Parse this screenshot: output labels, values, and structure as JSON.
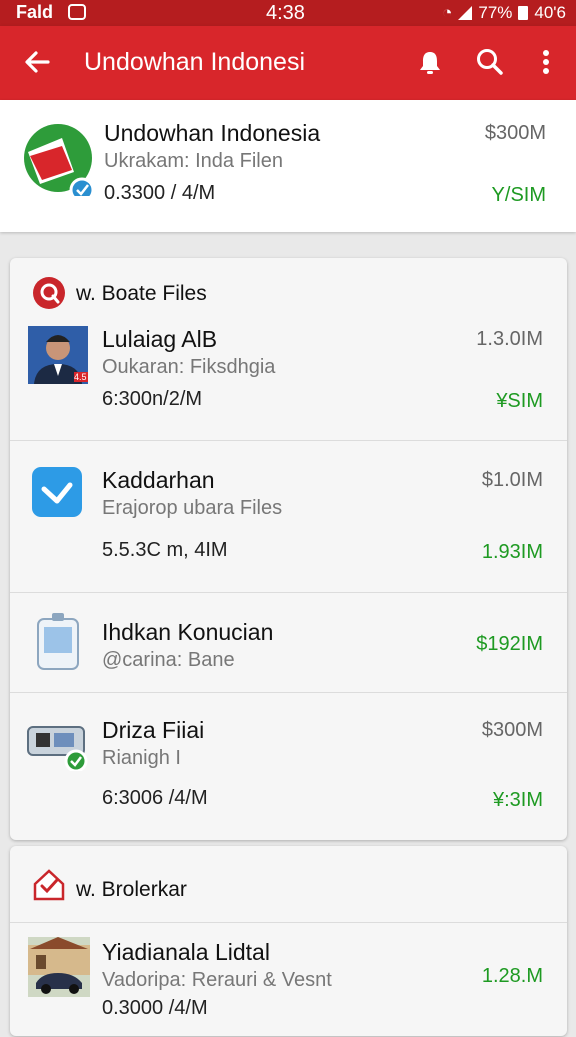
{
  "status_bar": {
    "left": "Fald",
    "time": "4:38",
    "battery": "77%",
    "right": "40'6"
  },
  "app_bar": {
    "title": "Undowhan Indonesi"
  },
  "top_item": {
    "name": "Undowhan Indonesia",
    "sub": "Ukrakam: Inda Filen",
    "meta": "0.3300 / 4/M",
    "price": "$300M",
    "green": "Y/SIM"
  },
  "section1": {
    "title": "w. Boate Files",
    "items": [
      {
        "name": "Lulaiag AlB",
        "sub": "Oukaran: Fiksdhgia",
        "meta": "6:300n/2/M",
        "price": "1.3.0IM",
        "green": "¥SIM",
        "badge": "4.5"
      },
      {
        "name": "Kaddarhan",
        "sub": "Erajorop ubara Files",
        "meta": "5.5.3C m, 4IM",
        "price": "$1.0IM",
        "green": "1.93IM"
      },
      {
        "name": "Ihdkan Konucian",
        "sub": "@carina: Bane",
        "meta": "",
        "price": "",
        "green": "$192IM"
      },
      {
        "name": "Driza Fiiai",
        "sub": "Rianigh I",
        "meta": "6:3006 /4/M",
        "price": "$300M",
        "green": "¥:3IM"
      }
    ]
  },
  "section2": {
    "title": "w. Brolerkar",
    "items": [
      {
        "name": "Yiadianala Lidtal",
        "sub": "Vadoripa: Rerauri & Vesnt",
        "meta": "0.3000 /4/M",
        "price": "",
        "green": "1.28.M"
      }
    ]
  },
  "colors": {
    "primary": "#d8262b",
    "status": "#b51d1f",
    "green": "#1e9a22"
  },
  "icons": [
    "back-arrow-icon",
    "bell-icon",
    "search-icon",
    "more-vert-icon",
    "app-logo-icon",
    "brand-r-icon",
    "home-check-icon"
  ]
}
